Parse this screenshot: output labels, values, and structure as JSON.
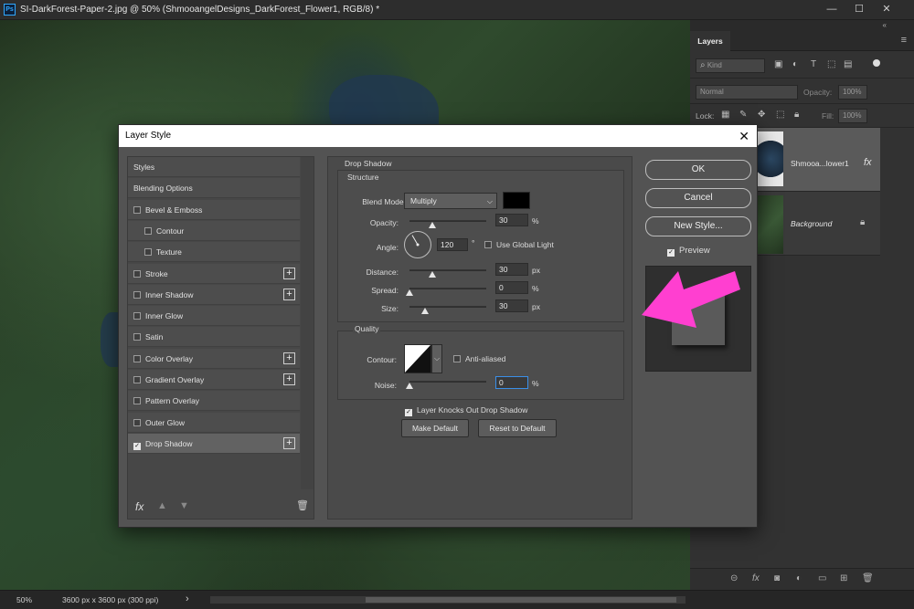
{
  "app": {
    "icon_label": "Ps",
    "title": "SI-DarkForest-Paper-2.jpg @ 50% (ShmooangelDesigns_DarkForest_Flower1, RGB/8) *",
    "window_buttons": [
      "—",
      "☐",
      "✕"
    ]
  },
  "layers_panel": {
    "collapse_glyph": "«",
    "tab_label": "Layers",
    "filter_placeholder": "Kind",
    "blend_mode": "Normal",
    "opacity_label": "Opacity:",
    "opacity_value": "100%",
    "lock_label": "Lock:",
    "fill_label": "Fill:",
    "fill_value": "100%",
    "layers": [
      {
        "name": "Shmooa...lower1",
        "fx": "fx"
      },
      {
        "name": "Background"
      }
    ]
  },
  "status_bar": {
    "zoom": "50%",
    "doc_info": "3600 px x 3600 px (300 ppi)",
    "arrow": "›"
  },
  "dialog": {
    "title": "Layer Style",
    "close": "✕",
    "styles_list": [
      {
        "label": "Styles",
        "checkbox": false,
        "plus": false,
        "indent": false
      },
      {
        "label": "Blending Options",
        "checkbox": false,
        "plus": false,
        "indent": false
      },
      {
        "label": "Bevel & Emboss",
        "checkbox": true,
        "checked": false,
        "plus": false,
        "indent": false
      },
      {
        "label": "Contour",
        "checkbox": true,
        "checked": false,
        "plus": false,
        "indent": true
      },
      {
        "label": "Texture",
        "checkbox": true,
        "checked": false,
        "plus": false,
        "indent": true
      },
      {
        "label": "Stroke",
        "checkbox": true,
        "checked": false,
        "plus": true,
        "indent": false
      },
      {
        "label": "Inner Shadow",
        "checkbox": true,
        "checked": false,
        "plus": true,
        "indent": false
      },
      {
        "label": "Inner Glow",
        "checkbox": true,
        "checked": false,
        "plus": false,
        "indent": false
      },
      {
        "label": "Satin",
        "checkbox": true,
        "checked": false,
        "plus": false,
        "indent": false
      },
      {
        "label": "Color Overlay",
        "checkbox": true,
        "checked": false,
        "plus": true,
        "indent": false
      },
      {
        "label": "Gradient Overlay",
        "checkbox": true,
        "checked": false,
        "plus": true,
        "indent": false
      },
      {
        "label": "Pattern Overlay",
        "checkbox": true,
        "checked": false,
        "plus": false,
        "indent": false
      },
      {
        "label": "Outer Glow",
        "checkbox": true,
        "checked": false,
        "plus": false,
        "indent": false
      },
      {
        "label": "Drop Shadow",
        "checkbox": true,
        "checked": true,
        "plus": true,
        "indent": false,
        "selected": true
      }
    ],
    "fx_label": "fx",
    "section_title": "Drop Shadow",
    "structure": {
      "title": "Structure",
      "blend_mode_label": "Blend Mode:",
      "blend_mode_value": "Multiply",
      "shadow_color": "#000000",
      "opacity_label": "Opacity:",
      "opacity_value": "30",
      "opacity_pct": 0.3,
      "angle_label": "Angle:",
      "angle_value": "120",
      "angle_unit": "°",
      "use_global_light_label": "Use Global Light",
      "use_global_light_checked": false,
      "distance_label": "Distance:",
      "distance_value": "30",
      "distance_slider": 0.3,
      "spread_label": "Spread:",
      "spread_value": "0",
      "spread_slider": 0,
      "size_label": "Size:",
      "size_value": "30",
      "size_slider": 0.2,
      "unit_px": "px",
      "unit_pct": "%"
    },
    "quality": {
      "title": "Quality",
      "contour_label": "Contour:",
      "anti_aliased_label": "Anti-aliased",
      "anti_aliased_checked": false,
      "noise_label": "Noise:",
      "noise_value": "0",
      "noise_slider": 0
    },
    "layer_knocks_out_label": "Layer Knocks Out Drop Shadow",
    "layer_knocks_out_checked": true,
    "make_default_label": "Make Default",
    "reset_default_label": "Reset to Default",
    "ok_label": "OK",
    "cancel_label": "Cancel",
    "new_style_label": "New Style...",
    "preview_label": "Preview",
    "preview_checked": true
  },
  "colors": {
    "annotation_arrow": "#ff3fd0",
    "ps_blue": "#31a8ff"
  }
}
